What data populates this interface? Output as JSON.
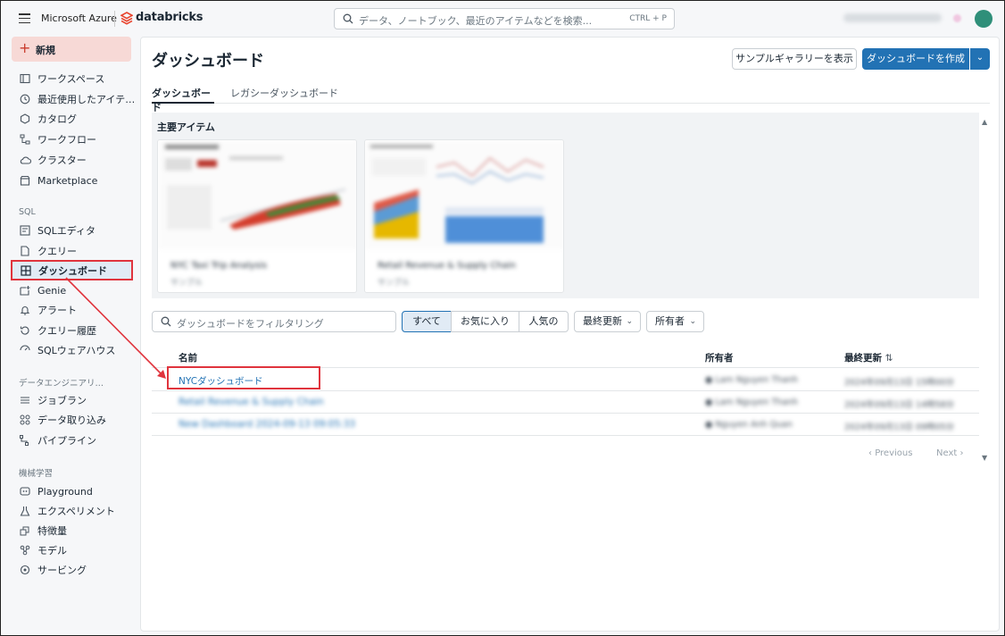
{
  "topbar": {
    "azure_label": "Microsoft Azure",
    "brand_label": "databricks",
    "search_placeholder": "データ、ノートブック、最近のアイテムなどを検索...",
    "search_shortcut": "CTRL + P"
  },
  "sidebar": {
    "new_label": "新規",
    "items_top": [
      {
        "label": "ワークスペース",
        "icon": "folder-icon"
      },
      {
        "label": "最近使用したアイテ…",
        "icon": "clock-icon"
      },
      {
        "label": "カタログ",
        "icon": "catalog-icon"
      },
      {
        "label": "ワークフロー",
        "icon": "workflow-icon"
      },
      {
        "label": "クラスター",
        "icon": "cloud-icon"
      },
      {
        "label": "Marketplace",
        "icon": "store-icon"
      }
    ],
    "section_sql": "SQL",
    "items_sql": [
      {
        "label": "SQLエディタ",
        "icon": "editor-icon"
      },
      {
        "label": "クエリー",
        "icon": "query-icon"
      },
      {
        "label": "ダッシュボード",
        "icon": "dashboard-icon"
      },
      {
        "label": "Genie",
        "icon": "genie-icon"
      },
      {
        "label": "アラート",
        "icon": "bell-icon"
      },
      {
        "label": "クエリー履歴",
        "icon": "history-icon"
      },
      {
        "label": "SQLウェアハウス",
        "icon": "warehouse-icon"
      }
    ],
    "section_de": "データエンジニアリ…",
    "items_de": [
      {
        "label": "ジョブラン",
        "icon": "jobs-icon"
      },
      {
        "label": "データ取り込み",
        "icon": "ingest-icon"
      },
      {
        "label": "パイプライン",
        "icon": "pipeline-icon"
      }
    ],
    "section_ml": "機械学習",
    "items_ml": [
      {
        "label": "Playground",
        "icon": "playground-icon"
      },
      {
        "label": "エクスペリメント",
        "icon": "flask-icon"
      },
      {
        "label": "特徴量",
        "icon": "feature-icon"
      },
      {
        "label": "モデル",
        "icon": "model-icon"
      },
      {
        "label": "サービング",
        "icon": "serving-icon"
      }
    ]
  },
  "main": {
    "title": "ダッシュボード",
    "gallery_button": "サンプルギャラリーを表示",
    "create_button": "ダッシュボードを作成",
    "tabs": [
      "ダッシュボード",
      "レガシーダッシュボード"
    ],
    "featured_title": "主要アイテム",
    "featured_cards": [
      {
        "title": "NYC Taxi Trip Analysis",
        "subtitle": "サンプル"
      },
      {
        "title": "Retail Revenue & Supply Chain",
        "subtitle": "サンプル"
      }
    ],
    "filter_placeholder": "ダッシュボードをフィルタリング",
    "segments": [
      "すべて",
      "お気に入り",
      "人気の"
    ],
    "sort_dropdown": "最終更新",
    "owner_dropdown": "所有者",
    "columns": {
      "name": "名前",
      "owner": "所有者",
      "updated": "最終更新"
    },
    "rows": [
      {
        "name": "NYCダッシュボード",
        "owner": "Lam Nguyen Thanh",
        "updated": "2024年09月13日 15時00分"
      },
      {
        "name": "Retail Revenue & Supply Chain",
        "owner": "Lam Nguyen Thanh",
        "updated": "2024年09月13日 14時58分"
      },
      {
        "name": "New Dashboard 2024-09-13 09:05:33",
        "owner": "Nguyen Anh Quan",
        "updated": "2024年09月13日 09時05分"
      }
    ],
    "pager_prev": "Previous",
    "pager_next": "Next"
  },
  "colors": {
    "accent": "#2272b4",
    "highlight": "#e0343d",
    "new_button_bg": "#f7d9d6"
  }
}
